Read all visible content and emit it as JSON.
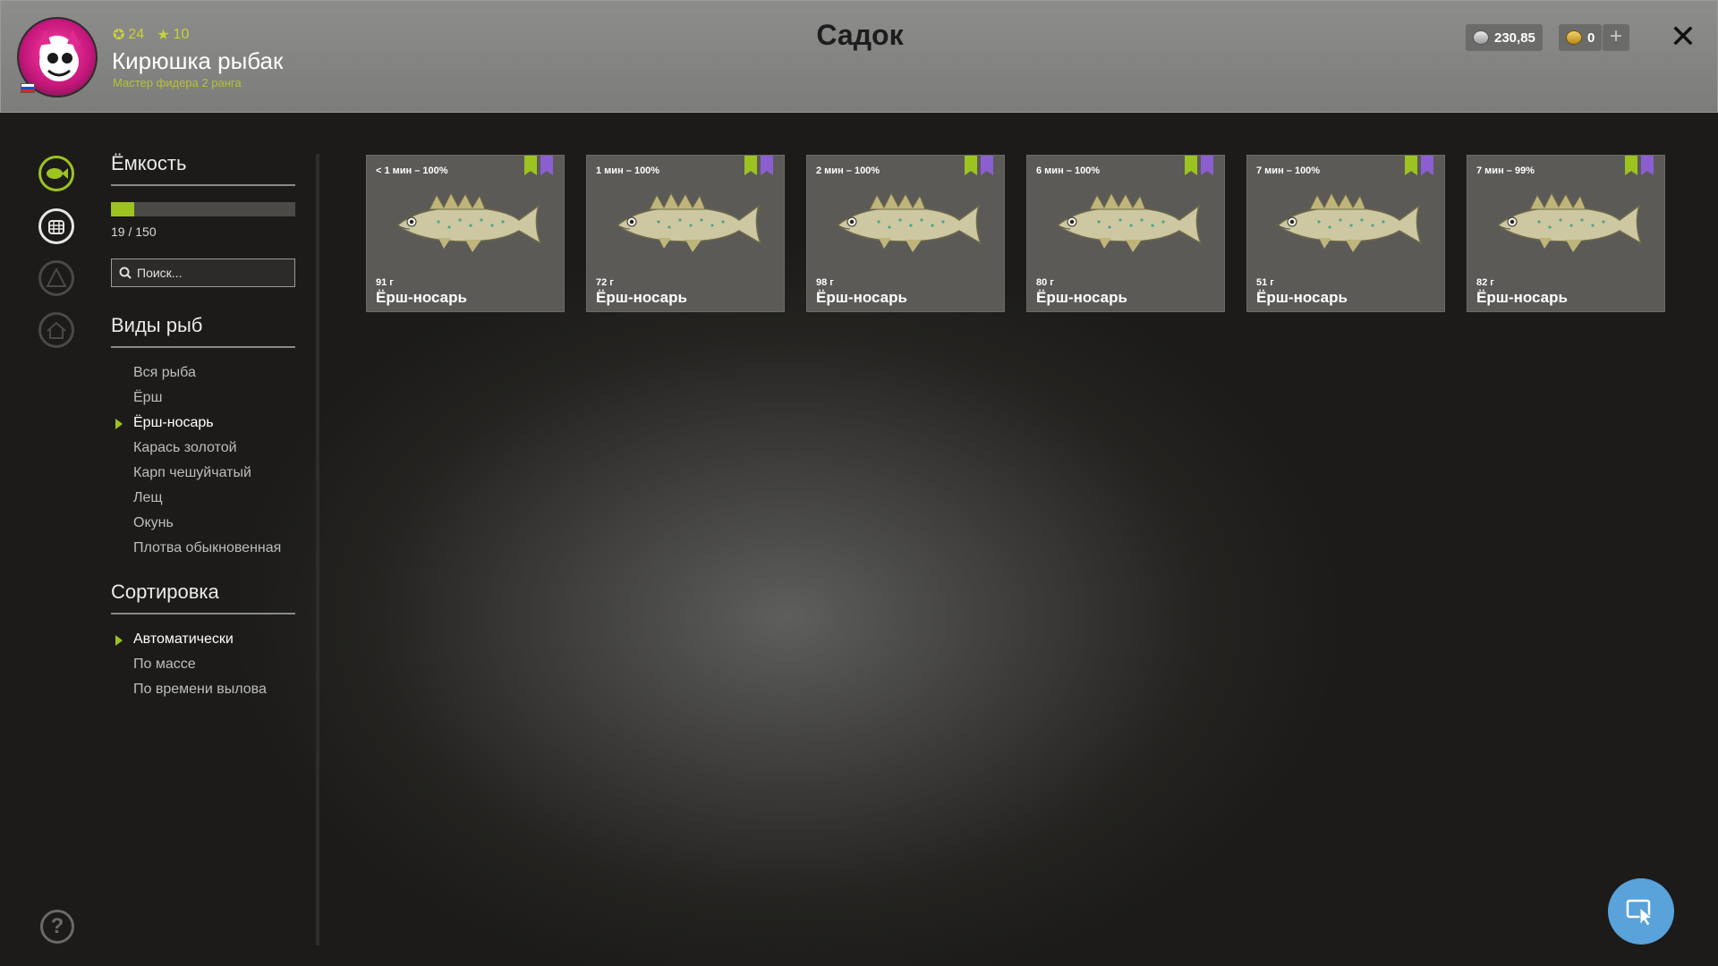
{
  "header": {
    "title": "Садок",
    "player": {
      "name": "Кирюшка рыбак",
      "rank": "Мастер фидера 2 ранга",
      "level": "24",
      "stars": "10"
    },
    "currency": {
      "silver": "230,85",
      "gold": "0"
    }
  },
  "sidebar": {
    "capacity": {
      "title": "Ёмкость",
      "text": "19 / 150",
      "fill_fraction": 0.127
    },
    "search": {
      "placeholder": "Поиск..."
    },
    "species": {
      "title": "Виды рыб",
      "items": [
        "Вся рыба",
        "Ёрш",
        "Ёрш-носарь",
        "Карась золотой",
        "Карп чешуйчатый",
        "Лещ",
        "Окунь",
        "Плотва обыкновенная"
      ],
      "selected_index": 2
    },
    "sorting": {
      "title": "Сортировка",
      "items": [
        "Автоматически",
        "По массе",
        "По времени вылова"
      ],
      "selected_index": 0
    }
  },
  "cards": [
    {
      "time": "< 1 мин – 100%",
      "weight": "91 г",
      "name": "Ёрш-носарь"
    },
    {
      "time": "1 мин – 100%",
      "weight": "72 г",
      "name": "Ёрш-носарь"
    },
    {
      "time": "2 мин – 100%",
      "weight": "98 г",
      "name": "Ёрш-носарь"
    },
    {
      "time": "6 мин – 100%",
      "weight": "80 г",
      "name": "Ёрш-носарь"
    },
    {
      "time": "7 мин – 100%",
      "weight": "51 г",
      "name": "Ёрш-носарь"
    },
    {
      "time": "7 мин – 99%",
      "weight": "82 г",
      "name": "Ёрш-носарь"
    }
  ],
  "colors": {
    "accent": "#9cc320",
    "bookmark_green": "#9cc320",
    "bookmark_purple": "#8b5fd0",
    "fab": "#5aa2da"
  },
  "icons": [
    "fish-icon",
    "keepnet-icon",
    "tackle-icon",
    "home-icon",
    "help-icon",
    "cursor-icon",
    "close-icon",
    "silver-coin-icon",
    "gold-coin-icon"
  ]
}
